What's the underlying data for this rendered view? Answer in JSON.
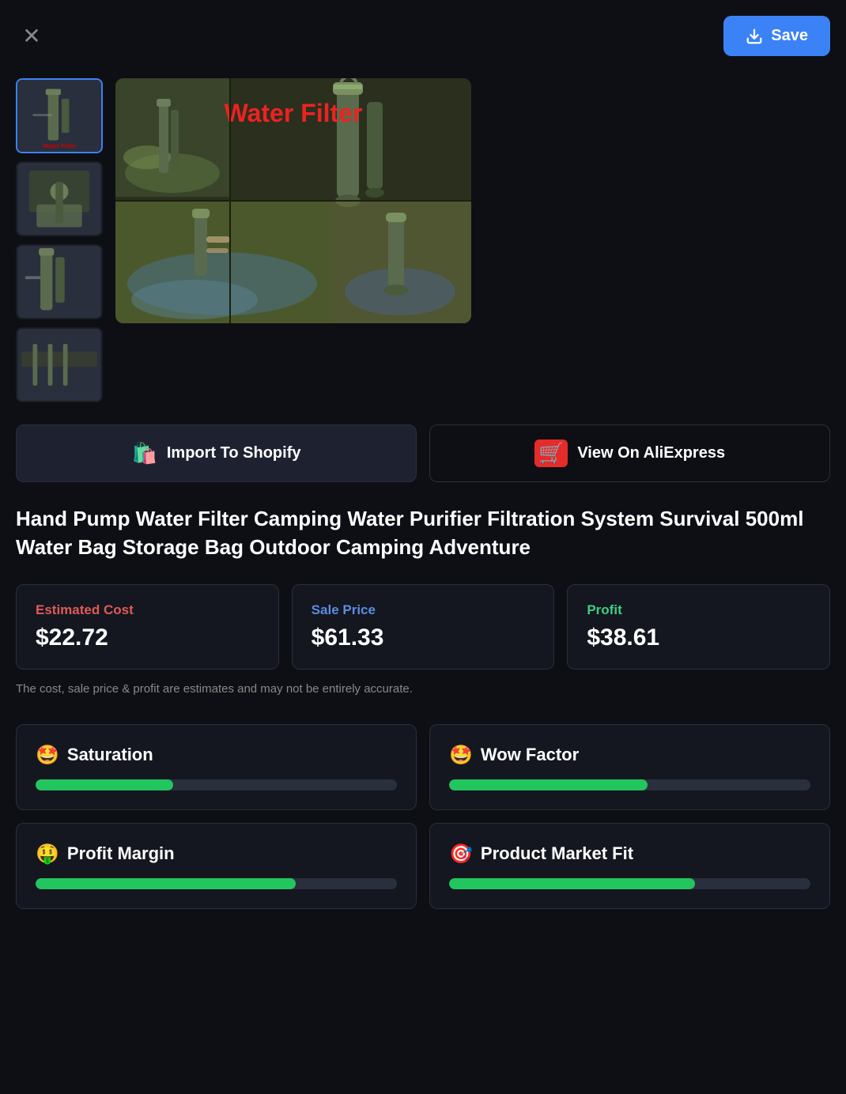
{
  "header": {
    "save_label": "Save",
    "close_icon": "✕"
  },
  "gallery": {
    "main_image_alt": "Water Filter main product image",
    "thumbnails": [
      {
        "alt": "Water Filter thumbnail 1",
        "active": true
      },
      {
        "alt": "Water Filter thumbnail 2",
        "active": false
      },
      {
        "alt": "Water Filter thumbnail 3",
        "active": false
      },
      {
        "alt": "Water Filter thumbnail 4",
        "active": false
      }
    ]
  },
  "actions": {
    "shopify_label": "Import To Shopify",
    "aliexpress_label": "View On AliExpress"
  },
  "product": {
    "title": "Hand Pump Water Filter Camping Water Purifier Filtration System Survival 500ml Water Bag Storage Bag Outdoor Camping Adventure"
  },
  "pricing": {
    "cost_label": "Estimated Cost",
    "cost_value": "$22.72",
    "sale_label": "Sale Price",
    "sale_value": "$61.33",
    "profit_label": "Profit",
    "profit_value": "$38.61",
    "disclaimer": "The cost, sale price & profit are estimates and may not be entirely accurate."
  },
  "metrics": [
    {
      "id": "saturation",
      "emoji": "🤩",
      "title": "Saturation",
      "progress": 38
    },
    {
      "id": "wow-factor",
      "emoji": "🤩",
      "title": "Wow Factor",
      "progress": 55
    },
    {
      "id": "profit-margin",
      "emoji": "🤑",
      "title": "Profit Margin",
      "progress": 72
    },
    {
      "id": "product-market-fit",
      "emoji": "🎯",
      "title": "Product Market Fit",
      "progress": 68
    }
  ],
  "colors": {
    "progress_fill": "#22c55e",
    "progress_bg": "#2a2f3d",
    "save_btn": "#3b82f6"
  }
}
